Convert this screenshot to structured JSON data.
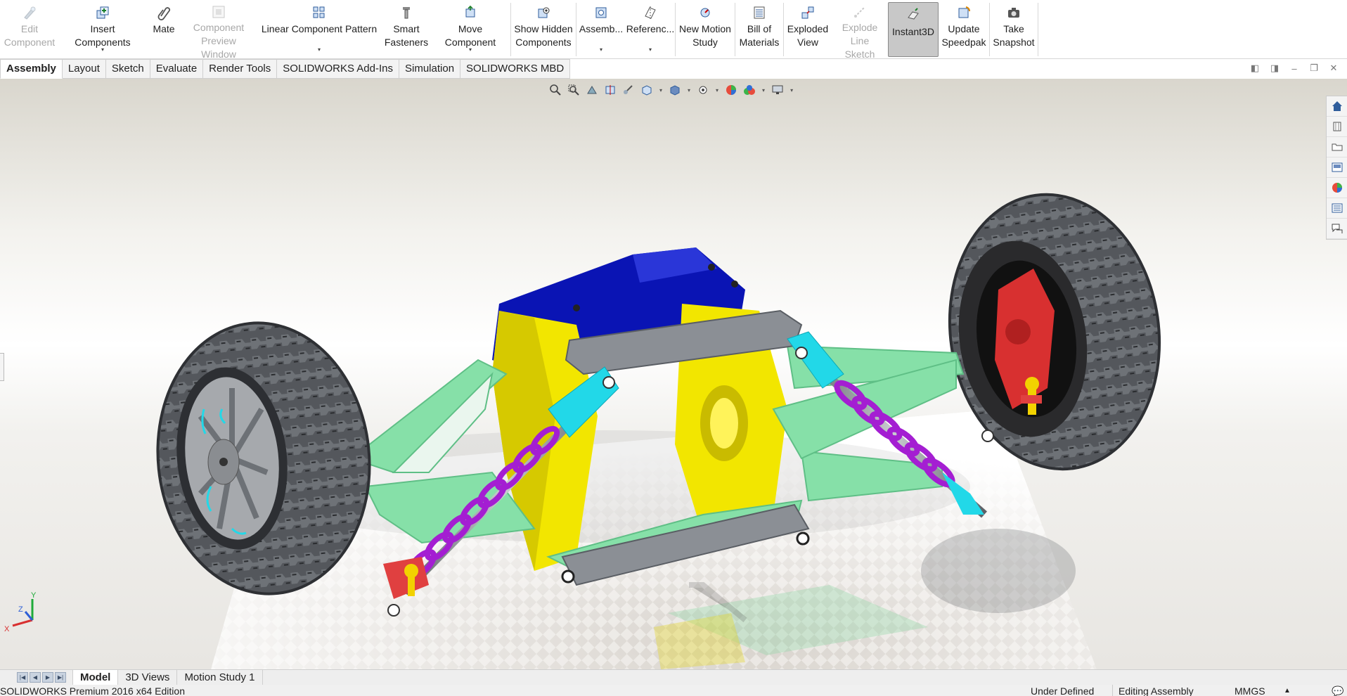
{
  "ribbon": {
    "edit_component": "Edit\nComponent",
    "insert_components": "Insert Components",
    "mate": "Mate",
    "component_preview": "Component\nPreview Window",
    "linear_pattern": "Linear Component Pattern",
    "smart_fasteners": "Smart\nFasteners",
    "move_component": "Move Component",
    "show_hidden": "Show Hidden\nComponents",
    "assembly_features": "Assemb...",
    "reference_geometry": "Referenc...",
    "new_motion_study": "New Motion\nStudy",
    "bill_of_materials": "Bill of\nMaterials",
    "exploded_view": "Exploded\nView",
    "explode_line_sketch": "Explode\nLine Sketch",
    "instant3d": "Instant3D",
    "update_speedpak": "Update\nSpeedpak",
    "take_snapshot": "Take\nSnapshot"
  },
  "tabs": [
    "Assembly",
    "Layout",
    "Sketch",
    "Evaluate",
    "Render Tools",
    "SOLIDWORKS Add-Ins",
    "Simulation",
    "SOLIDWORKS MBD"
  ],
  "bottom_tabs": [
    "Model",
    "3D Views",
    "Motion Study 1"
  ],
  "status": {
    "edition": "SOLIDWORKS Premium 2016 x64 Edition",
    "state": "Under Defined",
    "mode": "Editing Assembly",
    "units": "MMGS",
    "units_caret": "▲"
  },
  "triad": {
    "y": "Y",
    "z": "Z",
    "x": "X"
  },
  "colors": {
    "accent_active": "#c8c8c8",
    "frame_blue": "#0a14b4",
    "bracket_yellow": "#f2e600",
    "arm_green": "#86e0a8",
    "shock_cyan": "#22d8e8",
    "spring_purple": "#a41ed2",
    "hub_red": "#d83030",
    "tire_gray": "#4a4d52"
  }
}
